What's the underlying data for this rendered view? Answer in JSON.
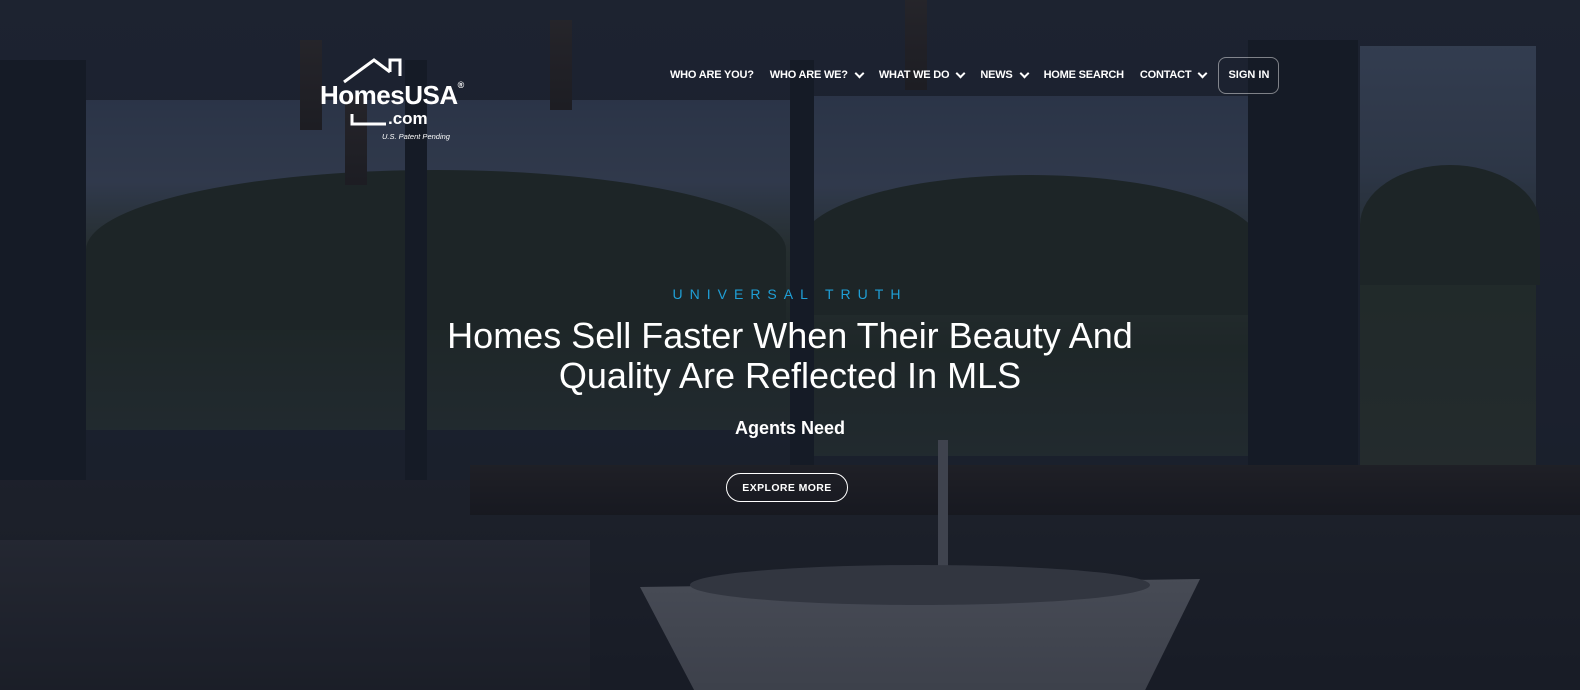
{
  "logo": {
    "name": "HomesUSA",
    "registered": "®",
    "dotcom": ".com",
    "tagline": "U.S. Patent Pending"
  },
  "nav": {
    "items": [
      {
        "label": "WHO ARE YOU?",
        "has_dropdown": false
      },
      {
        "label": "WHO ARE WE?",
        "has_dropdown": true
      },
      {
        "label": "WHAT WE DO",
        "has_dropdown": true
      },
      {
        "label": "NEWS",
        "has_dropdown": true
      },
      {
        "label": "HOME SEARCH",
        "has_dropdown": false
      },
      {
        "label": "CONTACT",
        "has_dropdown": true
      }
    ],
    "sign_in": "SIGN IN"
  },
  "hero": {
    "eyebrow": "UNIVERSAL TRUTH",
    "headline": "Homes Sell Faster When Their Beauty And Quality Are Reflected In MLS",
    "subhead": "Agents Need",
    "cta": "EXPLORE MORE"
  },
  "colors": {
    "accent": "#1f9fd6",
    "text": "#ffffff",
    "overlay": "#121826"
  },
  "icons": {
    "dropdown": "chevron-down-icon",
    "logo_mark": "house-outline-icon"
  }
}
